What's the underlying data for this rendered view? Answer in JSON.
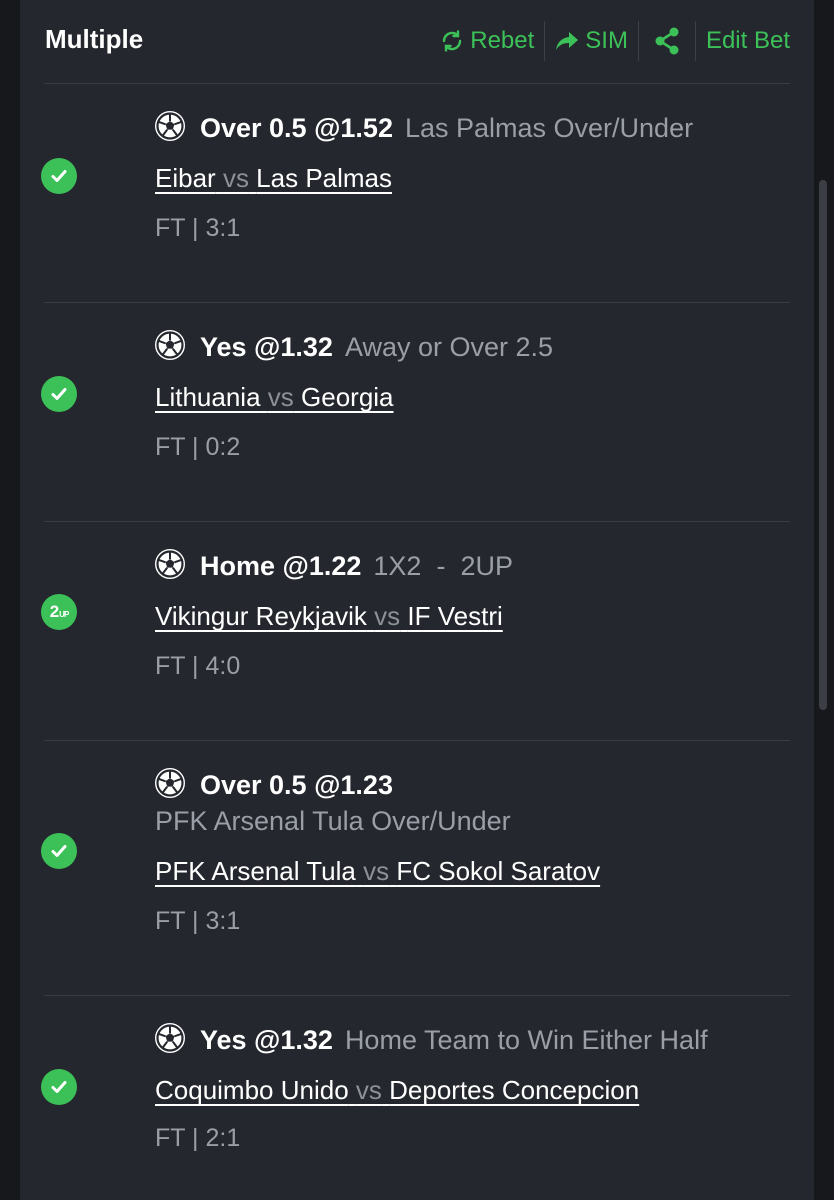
{
  "header": {
    "title": "Multiple",
    "rebet_label": "Rebet",
    "sim_label": "SIM",
    "edit_label": "Edit Bet"
  },
  "colors": {
    "accent": "#3cc159",
    "panel": "#24272d",
    "muted": "#9a9ea6"
  },
  "bets": [
    {
      "status": "won",
      "selection": "Over 0.5 @1.52",
      "market": "Las Palmas Over/Under",
      "home": "Eibar",
      "vs": "vs",
      "away": "Las Palmas",
      "result": "FT | 3:1"
    },
    {
      "status": "won",
      "selection": "Yes @1.32",
      "market": "Away or Over 2.5",
      "home": "Lithuania",
      "vs": "vs",
      "away": "Georgia",
      "result": "FT | 0:2"
    },
    {
      "status": "2up",
      "status_label": "2",
      "status_sub": "UP",
      "selection": "Home @1.22",
      "market": "1X2  -  2UP",
      "home": "Vikingur Reykjavik",
      "vs": "vs",
      "away": "IF Vestri",
      "result": "FT | 4:0"
    },
    {
      "status": "won",
      "selection": "Over 0.5 @1.23",
      "market": "PFK Arsenal Tula Over/Under",
      "home": "PFK Arsenal Tula",
      "vs": "vs",
      "away": "FC Sokol Saratov",
      "result": "FT | 3:1"
    },
    {
      "status": "won",
      "selection": "Yes @1.32",
      "market": "Home Team to Win Either Half",
      "home": "Coquimbo Unido",
      "vs": "vs",
      "away": "Deportes Concepcion",
      "result": "FT | 2:1"
    }
  ]
}
